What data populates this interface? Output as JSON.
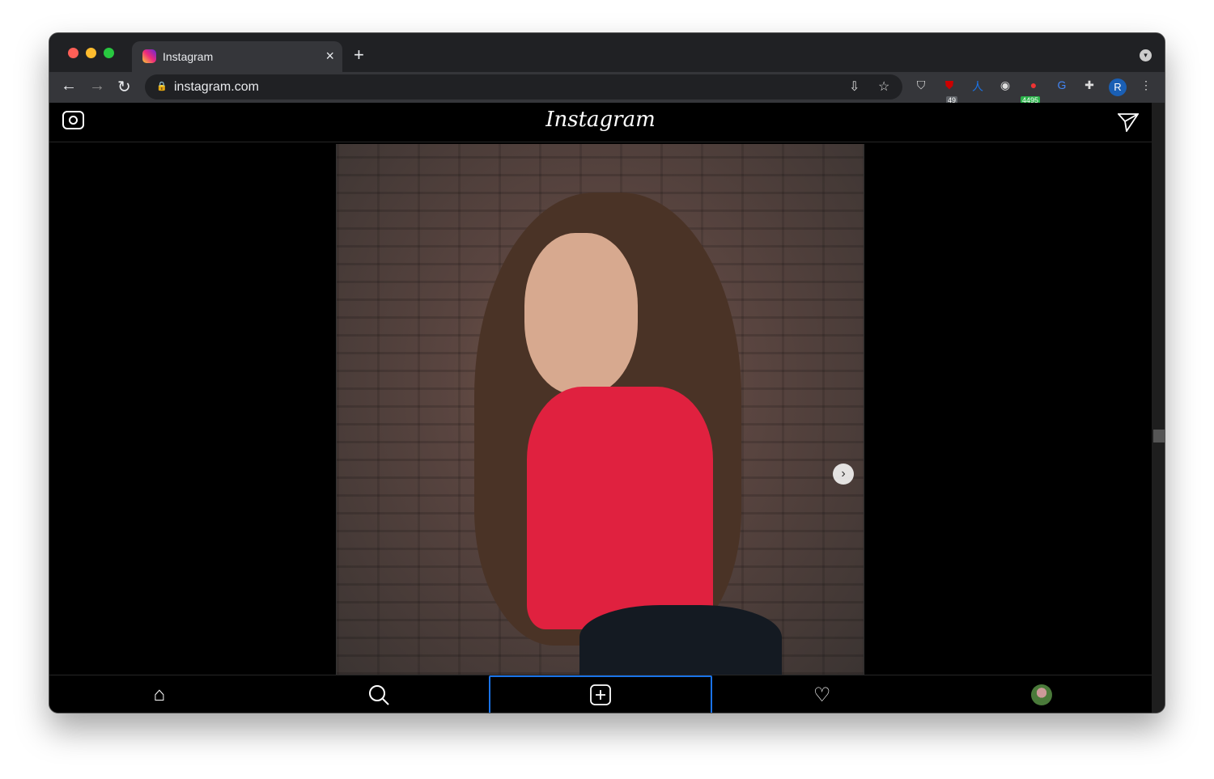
{
  "browser": {
    "tab_title": "Instagram",
    "url": "instagram.com",
    "close_glyph": "×",
    "new_tab_glyph": "+",
    "extensions": [
      {
        "name": "ublock",
        "badge": "49",
        "badge_color": "#5f6368"
      },
      {
        "name": "counter",
        "badge": "4495",
        "badge_color": "#2bb34a"
      }
    ],
    "profile_initial": "R"
  },
  "instagram": {
    "logo": "Instagram",
    "photo_alt": "Woman in red top against brick wall"
  },
  "colors": {
    "accent": "#1a73e8",
    "chrome_bg": "#202124"
  }
}
